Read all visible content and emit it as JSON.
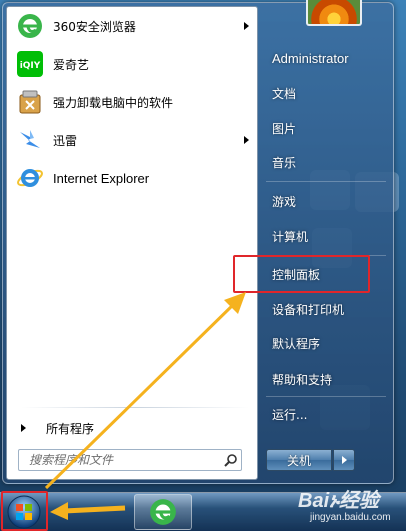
{
  "start_menu": {
    "pinned_programs": [
      {
        "label": "360安全浏览器",
        "icon": "360-browser-icon",
        "has_submenu": true
      },
      {
        "label": "爱奇艺",
        "icon": "iqiyi-icon",
        "has_submenu": false
      },
      {
        "label": "强力卸载电脑中的软件",
        "icon": "uninstaller-icon",
        "has_submenu": false
      },
      {
        "label": "迅雷",
        "icon": "thunder-icon",
        "has_submenu": true
      },
      {
        "label": "Internet Explorer",
        "icon": "internet-explorer-icon",
        "has_submenu": false
      }
    ],
    "all_programs_label": "所有程序",
    "search": {
      "placeholder": "搜索程序和文件"
    },
    "right_pane": {
      "user_name": "Administrator",
      "items": [
        {
          "label": "文档"
        },
        {
          "label": "图片"
        },
        {
          "label": "音乐"
        },
        {
          "label": "游戏"
        },
        {
          "label": "计算机"
        },
        {
          "label": "控制面板"
        },
        {
          "label": "设备和打印机"
        },
        {
          "label": "默认程序"
        },
        {
          "label": "帮助和支持"
        },
        {
          "label": "运行..."
        }
      ]
    },
    "shutdown_label": "关机"
  },
  "watermark": {
    "title": "Baiኑ经验",
    "url": "jingyan.baidu.com"
  },
  "colors": {
    "annotation_red": "#e0262a",
    "annotation_arrow": "#f5b21e"
  }
}
